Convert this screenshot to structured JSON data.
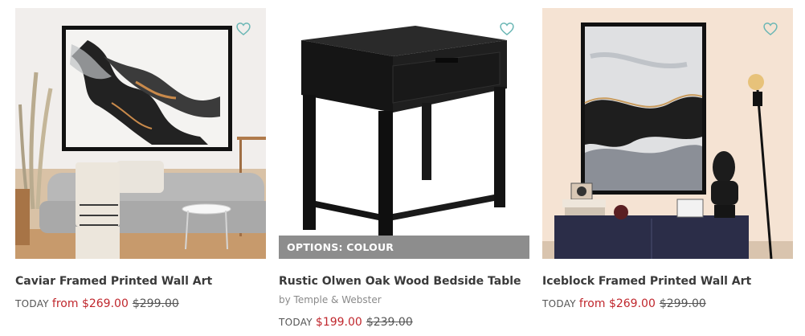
{
  "products": [
    {
      "title": "Caviar Framed Printed Wall Art",
      "price_label": "TODAY",
      "sale_price": "from $269.00",
      "was_price": "$299.00",
      "wishlist_icon": "heart-outline-icon"
    },
    {
      "title": "Rustic Olwen Oak Wood Bedside Table",
      "badge": "OPTIONS: COLOUR",
      "brand": "by Temple & Webster",
      "price_label": "TODAY",
      "sale_price": "$199.00",
      "was_price": "$239.00",
      "wishlist_icon": "heart-outline-icon"
    },
    {
      "title": "Iceblock Framed Printed Wall Art",
      "price_label": "TODAY",
      "sale_price": "from $269.00",
      "was_price": "$299.00",
      "wishlist_icon": "heart-outline-icon"
    }
  ],
  "colors": {
    "sale": "#c0272d",
    "title": "#3a3a3a",
    "badge_bg": "#8d8d8d",
    "wishlist": "#6bb7b5"
  }
}
